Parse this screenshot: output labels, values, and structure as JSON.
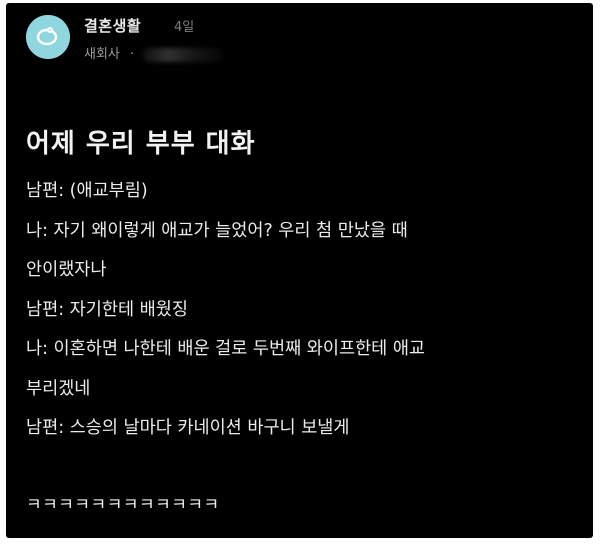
{
  "post": {
    "community": "결혼생활",
    "age": "4일",
    "company": "새회사",
    "separator": "·",
    "title": "어제 우리 부부 대화",
    "lines": [
      "남편: (애교부림)",
      "나: 자기 왜이렇게 애교가 늘었어? 우리 첨 만났을 때",
      "안이랬자나",
      "남편: 자기한테 배웠징",
      "나: 이혼하면 나한테 배운 걸로 두번째 와이프한테 애교",
      "부리겠네",
      "남편: 스승의 날마다 카네이션 바구니 보낼게"
    ],
    "laugh": "ㅋㅋㅋㅋㅋㅋㅋㅋㅋㅋㅋㅋ"
  },
  "colors": {
    "background": "#000000",
    "avatar": "#8fd6df",
    "text": "#ececec",
    "muted": "#9a9a9a"
  },
  "icons": {
    "avatar": "ring-icon"
  }
}
